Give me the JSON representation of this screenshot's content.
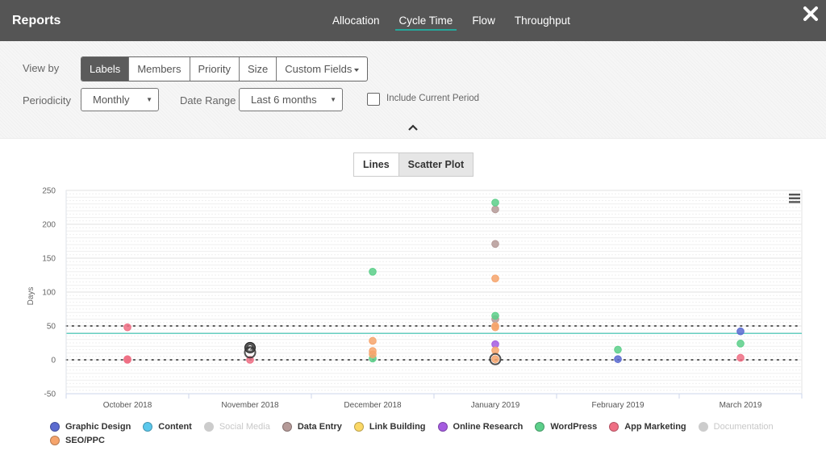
{
  "header": {
    "title": "Reports",
    "tabs": [
      {
        "label": "Allocation",
        "active": false
      },
      {
        "label": "Cycle Time",
        "active": true
      },
      {
        "label": "Flow",
        "active": false
      },
      {
        "label": "Throughput",
        "active": false
      }
    ],
    "close_icon": "close-icon"
  },
  "filters": {
    "view_by_label": "View by",
    "view_by_options": [
      {
        "label": "Labels",
        "active": true
      },
      {
        "label": "Members",
        "active": false
      },
      {
        "label": "Priority",
        "active": false
      },
      {
        "label": "Size",
        "active": false
      },
      {
        "label": "Custom Fields",
        "active": false,
        "dropdown": true
      }
    ],
    "periodicity_label": "Periodicity",
    "periodicity_value": "Monthly",
    "date_range_label": "Date Range",
    "date_range_value": "Last 6 months",
    "include_current_label": "Include Current Period",
    "include_current_checked": false,
    "collapse_icon": "chevron-up-icon"
  },
  "view_toggle": [
    {
      "label": "Lines",
      "active": false
    },
    {
      "label": "Scatter Plot",
      "active": true
    }
  ],
  "chart_menu_icon": "hamburger-menu-icon",
  "colors": {
    "accent": "#26a69a",
    "header_bg": "#555555"
  },
  "chart_data": {
    "type": "scatter",
    "title": "",
    "xlabel": "",
    "ylabel": "Days",
    "ylim": [
      -50,
      250
    ],
    "yticks": [
      250,
      200,
      150,
      100,
      50,
      0,
      -50
    ],
    "categories": [
      "October 2018",
      "November 2018",
      "December 2018",
      "January 2019",
      "February 2019",
      "March 2019"
    ],
    "grid": true,
    "legend_position": "bottom",
    "reference_lines": [
      {
        "name": "upper-limit",
        "value": 50,
        "style": "dotted",
        "color": "#444444"
      },
      {
        "name": "average",
        "value": 39,
        "style": "solid",
        "color": "#4ec9b8"
      },
      {
        "name": "lower-limit",
        "value": 0,
        "style": "dotted",
        "color": "#444444"
      }
    ],
    "series": [
      {
        "name": "Graphic Design",
        "color": "#5b6bd0",
        "visible": true,
        "points": [
          {
            "x": "February 2019",
            "y": 1
          },
          {
            "x": "March 2019",
            "y": 42
          }
        ]
      },
      {
        "name": "Content",
        "color": "#5bc8ec",
        "visible": true,
        "points": []
      },
      {
        "name": "Social Media",
        "color": "#cccccc",
        "visible": false,
        "points": []
      },
      {
        "name": "Data Entry",
        "color": "#b59a98",
        "visible": true,
        "points": [
          {
            "x": "January 2019",
            "y": 222
          },
          {
            "x": "January 2019",
            "y": 171
          },
          {
            "x": "January 2019",
            "y": 60
          }
        ]
      },
      {
        "name": "Link Building",
        "color": "#fbd866",
        "visible": true,
        "points": []
      },
      {
        "name": "Online Research",
        "color": "#a55ce0",
        "visible": true,
        "points": [
          {
            "x": "January 2019",
            "y": 23
          }
        ]
      },
      {
        "name": "WordPress",
        "color": "#5ccf8a",
        "visible": true,
        "points": [
          {
            "x": "December 2018",
            "y": 130
          },
          {
            "x": "December 2018",
            "y": 2
          },
          {
            "x": "January 2019",
            "y": 232
          },
          {
            "x": "January 2019",
            "y": 65
          },
          {
            "x": "February 2019",
            "y": 15
          },
          {
            "x": "March 2019",
            "y": 24
          }
        ]
      },
      {
        "name": "App Marketing",
        "color": "#ef6f84",
        "visible": true,
        "points": [
          {
            "x": "October 2018",
            "y": 48
          },
          {
            "x": "October 2018",
            "y": 1
          },
          {
            "x": "October 2018",
            "y": 0
          },
          {
            "x": "November 2018",
            "y": 0
          },
          {
            "x": "March 2019",
            "y": 3
          }
        ]
      },
      {
        "name": "Documentation",
        "color": "#cccccc",
        "visible": false,
        "points": []
      },
      {
        "name": "SEO/PPC",
        "color": "#f6a46c",
        "visible": true,
        "points": [
          {
            "x": "December 2018",
            "y": 28
          },
          {
            "x": "December 2018",
            "y": 13
          },
          {
            "x": "December 2018",
            "y": 8
          },
          {
            "x": "January 2019",
            "y": 120
          },
          {
            "x": "January 2019",
            "y": 50
          },
          {
            "x": "January 2019",
            "y": 48
          },
          {
            "x": "January 2019",
            "y": 14
          },
          {
            "x": "January 2019",
            "y": 1
          }
        ]
      }
    ],
    "clusters": [
      {
        "x": "November 2018",
        "y": 18,
        "count": 2
      },
      {
        "x": "November 2018",
        "y": 11,
        "count": null
      },
      {
        "x": "January 2019",
        "y": 1,
        "count": null
      }
    ]
  }
}
